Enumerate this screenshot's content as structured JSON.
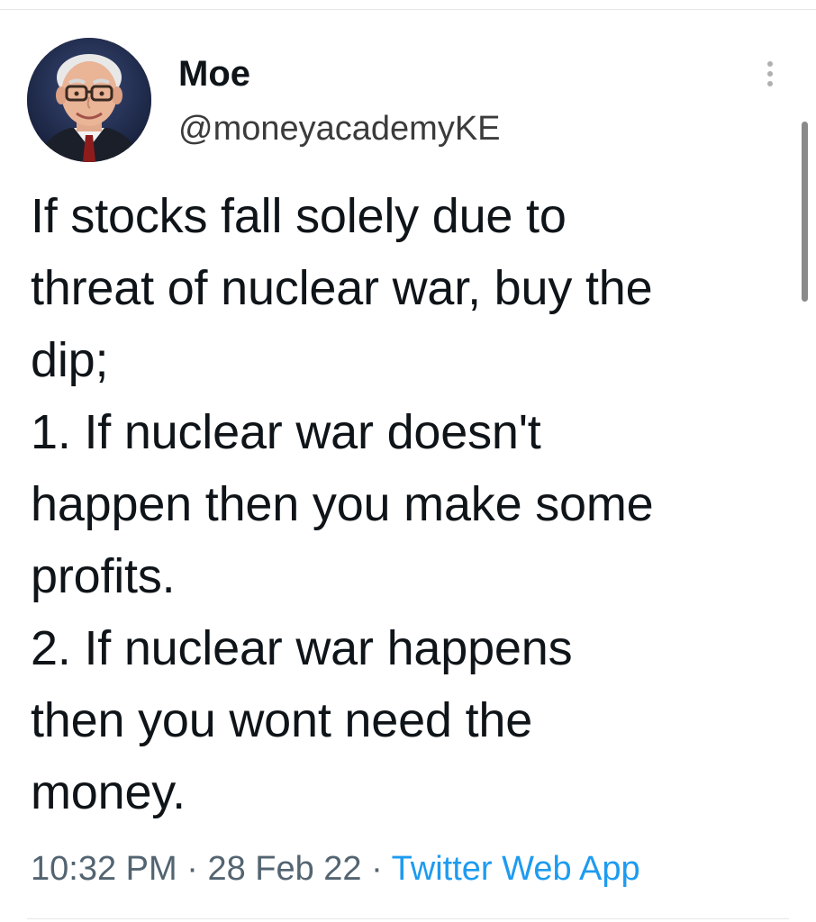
{
  "author": {
    "display_name": "Moe",
    "handle": "@moneyacademyKE"
  },
  "tweet": {
    "lines": [
      "If stocks fall solely due to",
      "threat of nuclear war, buy the",
      "dip;",
      "1. If nuclear war doesn't",
      "happen then you make some",
      "profits.",
      "2. If nuclear war happens",
      "then you wont need the",
      "money."
    ],
    "time": "10:32 PM",
    "separator": "·",
    "date": "28 Feb 22",
    "source": "Twitter Web App"
  },
  "icons": {
    "more": "more-vertical-icon",
    "avatar": "profile-photo"
  },
  "colors": {
    "text": "#0f1419",
    "meta": "#536471",
    "link": "#1d9bf0"
  }
}
